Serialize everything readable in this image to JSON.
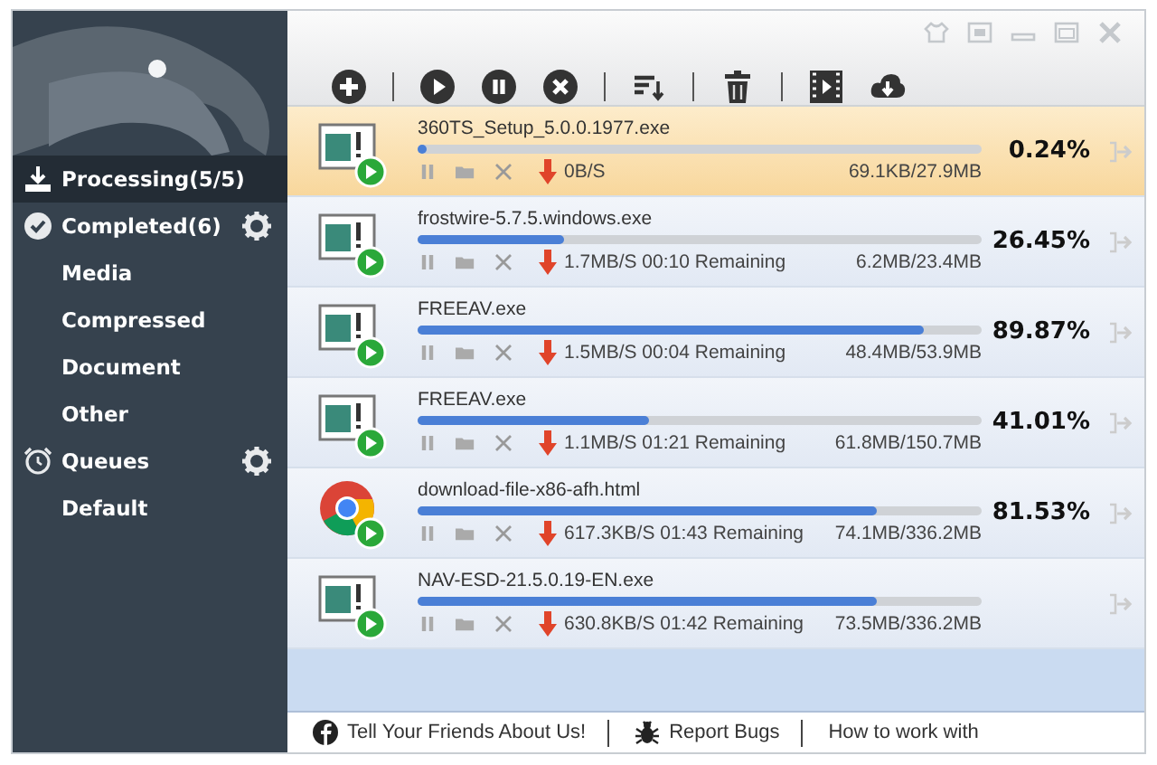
{
  "sidebar": {
    "items": [
      {
        "label": "Processing(5/5)",
        "kind": "active",
        "selected": true,
        "has_settings": false
      },
      {
        "label": "Completed(6)",
        "kind": "finished",
        "selected": false,
        "has_settings": true
      },
      {
        "label": "Media",
        "kind": "category",
        "selected": false,
        "has_settings": false
      },
      {
        "label": "Compressed",
        "kind": "category",
        "selected": false,
        "has_settings": false
      },
      {
        "label": "Document",
        "kind": "category",
        "selected": false,
        "has_settings": false
      },
      {
        "label": "Other",
        "kind": "category",
        "selected": false,
        "has_settings": false
      },
      {
        "label": "Queues",
        "kind": "queue",
        "selected": false,
        "has_settings": true
      },
      {
        "label": "Default",
        "kind": "category",
        "selected": false,
        "has_settings": false
      }
    ]
  },
  "downloads": [
    {
      "name": "360TS_Setup_5.0.0.1977.exe",
      "kind": "file",
      "selected": true,
      "level": 0.01,
      "speed": "0B/S",
      "size": "69.1KB/27.9MB",
      "percent": "0.24%"
    },
    {
      "name": "frostwire-5.7.5.windows.exe",
      "kind": "file",
      "selected": false,
      "level": 0.26,
      "speed": "1.7MB/S 00:10 Remaining",
      "size": "6.2MB/23.4MB",
      "percent": "26.45%"
    },
    {
      "name": "FREEAV.exe",
      "kind": "file",
      "selected": false,
      "level": 0.899,
      "speed": "1.5MB/S 00:04 Remaining",
      "size": "48.4MB/53.9MB",
      "percent": "89.87%"
    },
    {
      "name": "FREEAV.exe",
      "kind": "file",
      "selected": false,
      "level": 0.41,
      "speed": "1.1MB/S 01:21 Remaining",
      "size": "61.8MB/150.7MB",
      "percent": "41.01%"
    },
    {
      "name": "download-file-x86-afh.html",
      "kind": "web",
      "selected": false,
      "level": 0.815,
      "speed": "617.3KB/S 01:43 Remaining",
      "size": "74.1MB/336.2MB",
      "percent": "81.53%"
    },
    {
      "name": "NAV-ESD-21.5.0.19-EN.exe",
      "kind": "file",
      "selected": false,
      "level": 0.815,
      "speed": "630.8KB/S 01:42 Remaining",
      "size": "73.5MB/336.2MB"
    }
  ],
  "footer": {
    "links": [
      {
        "label": "Tell Your Friends About Us!",
        "kind": "share"
      },
      {
        "label": "Report Bugs",
        "kind": "bugs"
      },
      {
        "label": "How to work with",
        "kind": "help"
      }
    ]
  }
}
